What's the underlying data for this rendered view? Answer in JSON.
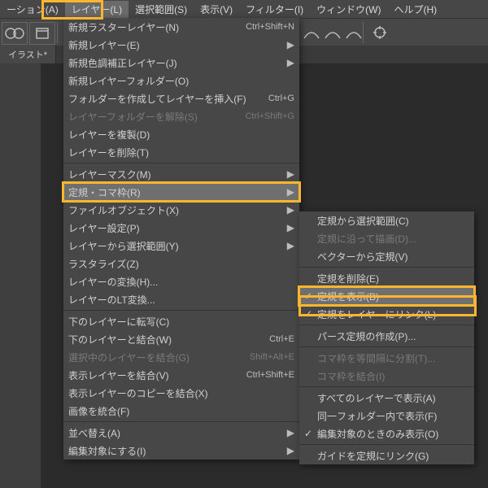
{
  "menubar": {
    "items": [
      {
        "label": "ーション(A)"
      },
      {
        "label": "レイヤー(L)",
        "open": true
      },
      {
        "label": "選択範囲(S)"
      },
      {
        "label": "表示(V)"
      },
      {
        "label": "フィルター(I)"
      },
      {
        "label": "ウィンドウ(W)"
      },
      {
        "label": "ヘルプ(H)"
      }
    ]
  },
  "tab": {
    "label": "イラスト*"
  },
  "dropdown": {
    "items": [
      {
        "label": "新規ラスターレイヤー(N)",
        "shortcut": "Ctrl+Shift+N"
      },
      {
        "label": "新規レイヤー(E)",
        "sub": true
      },
      {
        "label": "新規色調補正レイヤー(J)",
        "sub": true
      },
      {
        "label": "新規レイヤーフォルダー(O)"
      },
      {
        "label": "フォルダーを作成してレイヤーを挿入(F)",
        "shortcut": "Ctrl+G"
      },
      {
        "label": "レイヤーフォルダーを解除(S)",
        "shortcut": "Ctrl+Shift+G",
        "disabled": true
      },
      {
        "label": "レイヤーを複製(D)"
      },
      {
        "label": "レイヤーを削除(T)"
      },
      {
        "sep": true
      },
      {
        "label": "レイヤーマスク(M)",
        "sub": true
      },
      {
        "label": "定規・コマ枠(R)",
        "sub": true,
        "sel": true,
        "hl": true
      },
      {
        "label": "ファイルオブジェクト(X)",
        "sub": true
      },
      {
        "label": "レイヤー設定(P)",
        "sub": true
      },
      {
        "label": "レイヤーから選択範囲(Y)",
        "sub": true
      },
      {
        "label": "ラスタライズ(Z)"
      },
      {
        "label": "レイヤーの変換(H)..."
      },
      {
        "label": "レイヤーのLT変換..."
      },
      {
        "sep": true
      },
      {
        "label": "下のレイヤーに転写(C)"
      },
      {
        "label": "下のレイヤーと結合(W)",
        "shortcut": "Ctrl+E"
      },
      {
        "label": "選択中のレイヤーを結合(G)",
        "shortcut": "Shift+Alt+E",
        "disabled": true
      },
      {
        "label": "表示レイヤーを結合(V)",
        "shortcut": "Ctrl+Shift+E"
      },
      {
        "label": "表示レイヤーのコピーを結合(X)"
      },
      {
        "label": "画像を統合(F)"
      },
      {
        "sep": true
      },
      {
        "label": "並べ替え(A)",
        "sub": true
      },
      {
        "label": "編集対象にする(I)",
        "sub": true
      }
    ]
  },
  "submenu": {
    "items": [
      {
        "label": "定規から選択範囲(C)"
      },
      {
        "label": "定規に沿って描画(D)...",
        "disabled": true
      },
      {
        "label": "ベクターから定規(V)"
      },
      {
        "sep": true
      },
      {
        "label": "定規を削除(E)"
      },
      {
        "label": "定規を表示(B)",
        "sel": true,
        "chk": true,
        "hl": true
      },
      {
        "label": "定規をレイヤーにリンク(L)",
        "chk": true
      },
      {
        "sep": true
      },
      {
        "label": "パース定規の作成(P)..."
      },
      {
        "sep": true
      },
      {
        "label": "コマ枠を等間隔に分割(T)...",
        "disabled": true
      },
      {
        "label": "コマ枠を結合(I)",
        "disabled": true
      },
      {
        "sep": true
      },
      {
        "label": "すべてのレイヤーで表示(A)"
      },
      {
        "label": "同一フォルダー内で表示(F)"
      },
      {
        "label": "編集対象のときのみ表示(O)",
        "chk": true
      },
      {
        "sep": true
      },
      {
        "label": "ガイドを定規にリンク(G)"
      }
    ]
  }
}
